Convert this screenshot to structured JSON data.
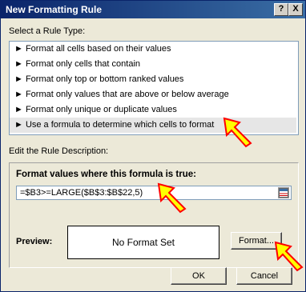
{
  "title": "New Formatting Rule",
  "titlebar": {
    "help": "?",
    "close": "X"
  },
  "select_label": "Select a Rule Type:",
  "rule_types": [
    "► Format all cells based on their values",
    "► Format only cells that contain",
    "► Format only top or bottom ranked values",
    "► Format only values that are above or below average",
    "► Format only unique or duplicate values",
    "► Use a formula to determine which cells to format"
  ],
  "selected_index": 5,
  "edit_label": "Edit the Rule Description:",
  "desc": {
    "title": "Format values where this formula is true:",
    "formula": "=$B3>=LARGE($B$3:$B$22,5)",
    "preview_label": "Preview:",
    "preview_text": "No Format Set",
    "format_button": "Format..."
  },
  "buttons": {
    "ok": "OK",
    "cancel": "Cancel"
  },
  "colors": {
    "arrow_fill": "#ffff00",
    "arrow_stroke": "#ff0000",
    "title_bar": "#0a246a"
  },
  "icons": {
    "picker": "range-picker-icon",
    "arrow": "annotation-arrow-icon"
  }
}
